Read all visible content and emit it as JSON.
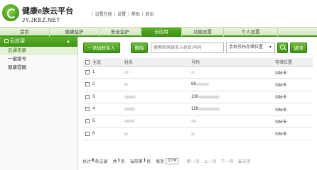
{
  "header": {
    "title": "健康e族云平台",
    "subtitle": "JY.JKEZ.NET",
    "links": [
      "设置在线",
      "设置",
      "帮助",
      "退出"
    ]
  },
  "nav": {
    "tabs": [
      "首页",
      "健康监护",
      "安全监护",
      "云应用",
      "功能设置",
      "个人设置"
    ],
    "active": "云应用"
  },
  "sidebar": {
    "title": "云应用",
    "items": [
      "云通讯录",
      "一键拨号",
      "健康提醒"
    ],
    "active": "云通讯录"
  },
  "toolbar": {
    "add_label": "+ 添加联系人",
    "delete_label": "删除",
    "search_placeholder": "搜索所有联系人姓名/号码",
    "storage_select": "手机号码存储位置",
    "back_label": "返回"
  },
  "table": {
    "headers": {
      "select_all": "全选",
      "name": "姓名",
      "number": "号码",
      "location": "存储位置"
    },
    "rows": [
      {
        "index": "1",
        "number_prefix": "",
        "location": "SIM卡"
      },
      {
        "index": "2",
        "number_prefix": "68",
        "location": "SIM卡"
      },
      {
        "index": "3",
        "number_prefix": "130",
        "location": "SIM卡"
      },
      {
        "index": "4",
        "number_prefix": "159",
        "location": "SIM卡"
      },
      {
        "index": "5",
        "number_prefix": "",
        "location": "SIM卡"
      },
      {
        "index": "6",
        "number_prefix": "",
        "location": "SIM卡"
      }
    ]
  },
  "pager": {
    "total_prefix": "总计",
    "total": "6",
    "total_suffix": "条记录",
    "pages_prefix": "共",
    "pages": "1",
    "pages_suffix": "页",
    "current_prefix": "当前第",
    "current": "1",
    "current_suffix": "页",
    "per_page_label": "每页",
    "per_page": "10",
    "first": "第一页",
    "prev": "上一页",
    "next": "下一页",
    "last": "最末页"
  },
  "colors": {
    "accent": "#3e9a17",
    "accent_light": "#e3f1d6"
  }
}
